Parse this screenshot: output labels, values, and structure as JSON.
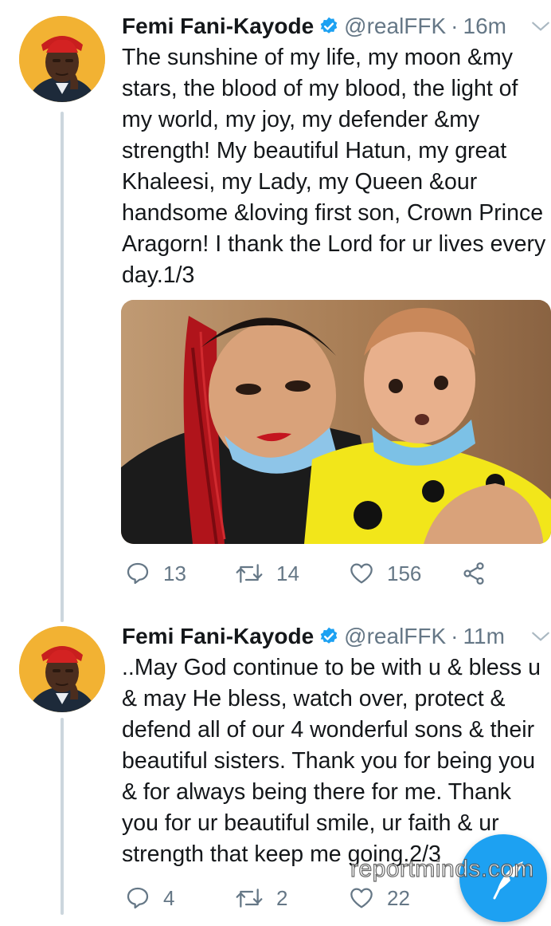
{
  "tweets": [
    {
      "name": "Femi Fani-Kayode",
      "handle": "@realFFK",
      "separator": "·",
      "time": "16m",
      "lines": [
        "The sunshine of my life, my moon &my",
        "stars, the blood of my blood, the light of",
        "my world, my joy, my defender &my",
        "strength! My beautiful Hatun, my great",
        "Khaleesi, my Lady, my Queen &our",
        "handsome &loving first son, Crown Prince",
        "Aragorn! I thank the Lord for ur lives every",
        "day.1/3"
      ],
      "has_photo": true,
      "replies": "13",
      "retweets": "14",
      "likes": "156"
    },
    {
      "name": "Femi Fani-Kayode",
      "handle": "@realFFK",
      "separator": "·",
      "time": "11m",
      "lines": [
        "..May God continue to be with u & bless u",
        "& may He bless, watch over, protect &",
        "defend all of our 4 wonderful sons & their",
        "beautiful sisters. Thank you for being you",
        "& for always being there for me. Thank",
        "you for ur beautiful smile, ur faith & ur",
        "strength that keep me going.2/3"
      ],
      "has_photo": false,
      "replies": "4",
      "retweets": "2",
      "likes": "22"
    }
  ],
  "watermark": "reportminds.com",
  "icons": {
    "verified": "verified-badge-icon",
    "chevron": "chevron-down-icon",
    "reply": "reply-icon",
    "retweet": "retweet-icon",
    "like": "heart-icon",
    "share": "share-icon",
    "compose": "compose-feather-icon"
  },
  "colors": {
    "accent": "#1da1f2",
    "muted": "#657786",
    "thread_line": "#ccd6dd",
    "text": "#14171a"
  }
}
